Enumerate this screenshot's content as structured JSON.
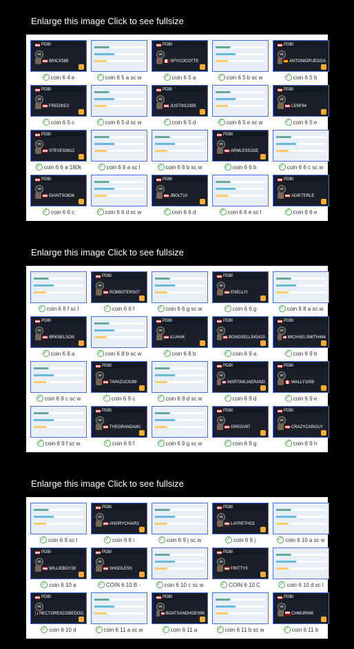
{
  "caption_prefix": "Enlarge this image",
  "caption_suffix": "Click to see fullsize",
  "sections": [
    {
      "cells": [
        {
          "dark": true,
          "p1": "PDBI",
          "p2": "BRICK589",
          "f2": "us",
          "lbl": "coin 6 4 e"
        },
        {
          "dark": false,
          "lbl": "coin 6 5 a sc w"
        },
        {
          "dark": true,
          "p1": "PDBI",
          "p2": "SPYCOCOTTE",
          "f2": "ca",
          "lbl": "coin 6 5 a"
        },
        {
          "dark": false,
          "lbl": "coin 6 5 b sc w"
        },
        {
          "dark": true,
          "p1": "PDBI",
          "p2": "ANTONIOPUEGGA",
          "f2": "es",
          "lbl": "coin 6 5 b"
        },
        {
          "dark": true,
          "p1": "PDBI",
          "p2": "FREDIKE2",
          "f2": "us",
          "lbl": "coin 6 5 c"
        },
        {
          "dark": false,
          "lbl": "coin 6 5 d sc w"
        },
        {
          "dark": true,
          "p1": "PDBI",
          "p2": "JUSTIN12395",
          "f2": "us",
          "lbl": "coin 6 5 d"
        },
        {
          "dark": false,
          "lbl": "coin 6 5 e sc w"
        },
        {
          "dark": true,
          "p1": "PDBI",
          "p2": "LENF64",
          "f2": "us",
          "lbl": "coin 6 5 e"
        },
        {
          "dark": true,
          "p1": "PDBI",
          "p2": "STEVESIM12",
          "f2": "us",
          "lbl": "coin 6 6 a 180k"
        },
        {
          "dark": false,
          "lbl": "coin 6 6 a sc l"
        },
        {
          "dark": false,
          "lbl": "coin 6 6 b sc w"
        },
        {
          "dark": true,
          "p1": "PDBI",
          "p2": "ARMLESSJOE",
          "f2": "us",
          "lbl": "coin 6 6 b"
        },
        {
          "dark": false,
          "lbl": "coin 6 6 c sc w"
        },
        {
          "dark": true,
          "p1": "PDBI",
          "p2": "GIANTSO826",
          "f2": "us",
          "lbl": "coin 6 6 c"
        },
        {
          "dark": false,
          "lbl": "coin 6 6 d sc w"
        },
        {
          "dark": true,
          "p1": "PDBI",
          "p2": "JBOLT10",
          "f2": "us",
          "lbl": "coin 6 6 d"
        },
        {
          "dark": false,
          "lbl": "coin 6 6 e sc l"
        },
        {
          "dark": true,
          "p1": "PDBI",
          "p2": "ADIETERLE",
          "f2": "us",
          "lbl": "coin 6 6 e"
        }
      ]
    },
    {
      "cells": [
        {
          "dark": false,
          "lbl": "coin 6 6 f sc l"
        },
        {
          "dark": true,
          "p1": "PDBI",
          "p2": "ROBBSTERS07",
          "f2": "us",
          "lbl": "coin 6 6 f"
        },
        {
          "dark": false,
          "lbl": "coin 6 6 g sc w"
        },
        {
          "dark": true,
          "p1": "PDBI",
          "p2": "ENELLYI",
          "f2": "us",
          "lbl": "coin 6 6 g"
        },
        {
          "dark": false,
          "lbl": "coin 6 8 a sc w"
        },
        {
          "dark": true,
          "p1": "PDBI",
          "p2": "BRKNELSON",
          "f2": "us",
          "lbl": "coin 6 8 a"
        },
        {
          "dark": false,
          "lbl": "coin 6 8 b sc w"
        },
        {
          "dark": true,
          "p1": "PDBI",
          "p2": "ILUHAK",
          "f2": "us",
          "lbl": "coin 6 8 b"
        },
        {
          "dark": true,
          "p1": "PDBI",
          "p2": "BONGSELLING420",
          "f2": "us",
          "lbl": "coin 6 9 a"
        },
        {
          "dark": true,
          "p1": "PDBI",
          "p2": "MICHAELSMITH444",
          "f2": "us",
          "lbl": "coin 6 9 b"
        },
        {
          "dark": false,
          "lbl": "coin 6 9 c sc w"
        },
        {
          "dark": true,
          "p1": "PDBI",
          "p2": "TAPAZUCKI99",
          "f2": "us",
          "lbl": "coin 6 9 c"
        },
        {
          "dark": false,
          "lbl": "coin 6 9 d sc w"
        },
        {
          "dark": true,
          "p1": "PDBI",
          "p2": "MARTINKJAERAND",
          "f2": "us",
          "lbl": "coin 6 9 d"
        },
        {
          "dark": true,
          "p1": "PDBI",
          "p2": "WALLY1059",
          "f2": "ca",
          "lbl": "coin 6 9 e"
        },
        {
          "dark": false,
          "lbl": "coin 6 9 f sc w"
        },
        {
          "dark": true,
          "p1": "PDBI",
          "p2": "THEGRANDAIKI",
          "f2": "us",
          "lbl": "coin 6 9 f"
        },
        {
          "dark": false,
          "lbl": "coin 6 9 g sc w"
        },
        {
          "dark": true,
          "p1": "PDBI",
          "p2": "GREGV87",
          "f2": "us",
          "lbl": "coin 6 9 g"
        },
        {
          "dark": true,
          "p1": "PDBI",
          "p2": "CRAZYCARGUY",
          "f2": "us",
          "lbl": "coin 6 9 h"
        }
      ]
    },
    {
      "cells": [
        {
          "dark": false,
          "lbl": "coin 6 9 sc l"
        },
        {
          "dark": true,
          "p1": "PDBI",
          "p2": "ANGRYCHAIR1",
          "f2": "us",
          "lbl": "coin 6 9 i"
        },
        {
          "dark": false,
          "lbl": "coin 6 9 j sc w"
        },
        {
          "dark": true,
          "p1": "PDBI",
          "p2": "LAYRETHO1",
          "f2": "us",
          "lbl": "coin 6 9 j"
        },
        {
          "dark": false,
          "lbl": "coin 6 10 a sc w"
        },
        {
          "dark": true,
          "p1": "PDBI",
          "p2": "WILLIEBOY28",
          "f2": "us",
          "lbl": "coin 6 10 a"
        },
        {
          "dark": true,
          "p1": "PDBI",
          "p2": "SHOOLESS",
          "f2": "us",
          "lbl": "COIN 6 10 B -"
        },
        {
          "dark": false,
          "lbl": "coin 6 10 c sc w"
        },
        {
          "dark": true,
          "p1": "PDBI",
          "p2": "FRITTY3",
          "f2": "us",
          "lbl": "COIN 6 10 C"
        },
        {
          "dark": false,
          "lbl": "coin 6 10 d sc l"
        },
        {
          "dark": true,
          "p1": "PDBI",
          "p2": "HECTORESCOBEDOO",
          "f2": "us",
          "lbl": "coin 6 10 d"
        },
        {
          "dark": false,
          "lbl": "coin 6 11 a sc w"
        },
        {
          "dark": true,
          "p1": "PDBI",
          "p2": "BOATSANDHOES90",
          "f2": "us",
          "lbl": "coin 6 11 a"
        },
        {
          "dark": false,
          "lbl": "coin 6 11 b sc w"
        },
        {
          "dark": true,
          "p1": "PDBI",
          "p2": "CHMURNIK",
          "f2": "pl",
          "lbl": "coin 6 11 b"
        }
      ]
    }
  ]
}
